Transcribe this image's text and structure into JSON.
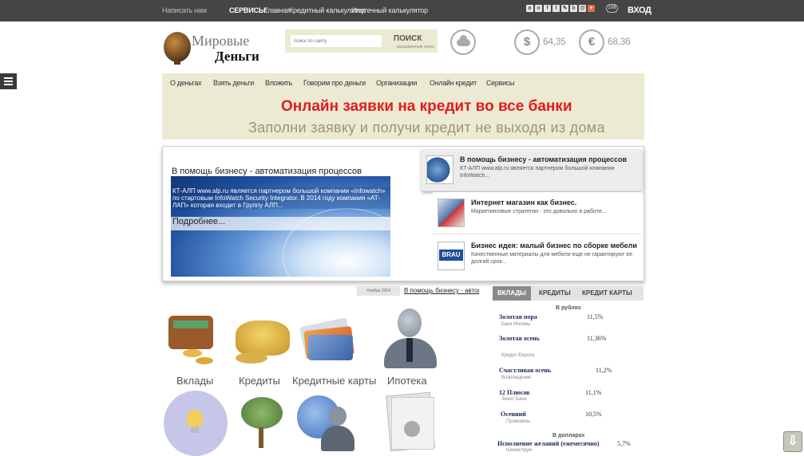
{
  "topbar": {
    "write_us": "Написать нам",
    "services_label": "СЕРВИСЫ:",
    "links": [
      "Главная",
      "Кредитный калькулятор",
      "Ипотечный калькулятор"
    ],
    "social_icons": [
      "vk-icon",
      "odnoklassniki-icon",
      "facebook-icon",
      "twitter-icon",
      "livejournal-icon",
      "blogger-icon",
      "mail-icon",
      "plus-icon"
    ],
    "share_count": "109",
    "login": "ВХОД"
  },
  "logo": {
    "line1": "Мировые",
    "line2": "Деньги"
  },
  "search": {
    "placeholder": "поиск по сайту",
    "button": "ПОИСК",
    "sub": "расширенный поиск"
  },
  "currency": [
    {
      "symbol": "$",
      "value": "64,35"
    },
    {
      "symbol": "€",
      "value": "68,36"
    }
  ],
  "nav": [
    "О деньгах",
    "Взять деньги",
    "Вложить",
    "Говорим про деньги",
    "Организации",
    "Онлайн кредит",
    "Сервисы"
  ],
  "banner": {
    "title": "Онлайн заявки на кредит во все банки",
    "subtitle": "Заполни заявку и получи кредит не выходя из дома"
  },
  "slider": {
    "title": "В помощь бизнесу - автоматизация процессов",
    "text": "КТ-АЛП www.alp.ru является партнером большой компании «Infowatch» по стартовым InfoWatch Security Integrator. В 2014 году компания «АТ-ЛАП» которая входит в Группу АЛП...",
    "more": "Подробнее...",
    "items": [
      {
        "title": "В помощь бизнесу - автоматизация процессов",
        "desc": "КТ-АЛП www.alp.ru является партнером большой компании InfoWatch..."
      },
      {
        "title": "Интернет магазин как бизнес.",
        "desc": "Маркетинговые стратегии - это довольно в работе..."
      },
      {
        "title": "Бизнес идея: малый бизнес по сборке мебели",
        "desc": "Качественные материалы для мебели еще не гарантируют ее долгий срок..."
      }
    ]
  },
  "date_badge": "Ноябрь 2014",
  "date_link": "В помощь бизнесу - автоматизация",
  "tiles": [
    "Вклады",
    "Кредиты",
    "Кредитные карты",
    "Ипотека"
  ],
  "rates": {
    "tabs": [
      "ВКЛАДЫ",
      "КРЕДИТЫ",
      "КРЕДИТ КАРТЫ"
    ],
    "head_rub": "В рублях",
    "head_usd": "В долларах",
    "rows": [
      {
        "name": "Золотая пора",
        "bank": "Банк Москвы",
        "value": "11,5%"
      },
      {
        "name": "Золотая осень",
        "bank": "Кредит Европа",
        "value": "11,36%"
      },
      {
        "name": "Счастливая осень",
        "bank": "Возрождение",
        "value": "11,2%"
      },
      {
        "name": "12 Плюсов",
        "bank": "Зенит Банк",
        "value": "11,1%"
      },
      {
        "name": "Осенний",
        "bank": "Промсвязь",
        "value": "10,5%"
      },
      {
        "name": "Исполнение желаний (ежемесячно)",
        "bank": "Юниаструм",
        "value": "5,7%"
      }
    ]
  }
}
